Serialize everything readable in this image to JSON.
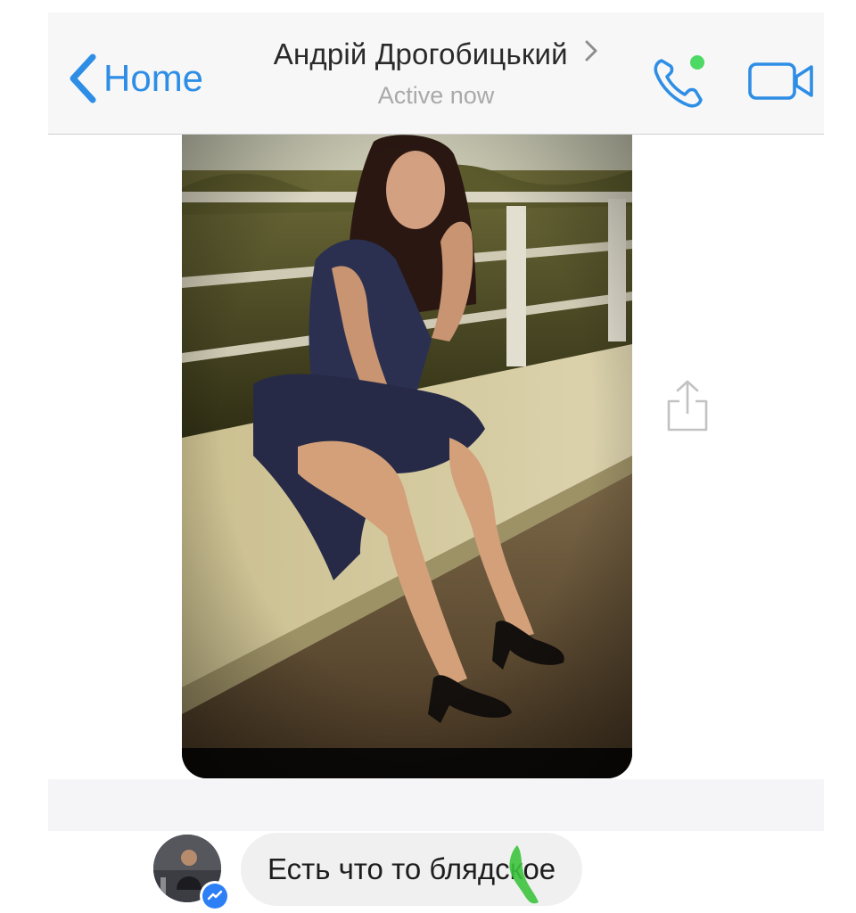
{
  "header": {
    "back_label": "Home",
    "contact_name": "Андрій Дрогобицький",
    "status": "Active now",
    "icons": {
      "back": "chevron-left-icon",
      "contact": "chevron-right-icon",
      "call": "phone-icon",
      "video": "video-camera-icon"
    }
  },
  "thread": {
    "shared_photo": {
      "kind": "image",
      "subject": "woman in dark dress sitting on a concrete bridge parapet"
    },
    "share_icon": "share-icon"
  },
  "message": {
    "text": "Есть что то блядское",
    "avatar": "contact-avatar",
    "badge_icon": "messenger-icon"
  },
  "colors": {
    "accent": "#2e8ee6",
    "online_dot": "#4cd964",
    "header_bg": "#f7f7f7",
    "bubble_bg": "#f0f0f0",
    "messenger_badge": "#2d7ff5",
    "marker": "#3cc33c"
  }
}
